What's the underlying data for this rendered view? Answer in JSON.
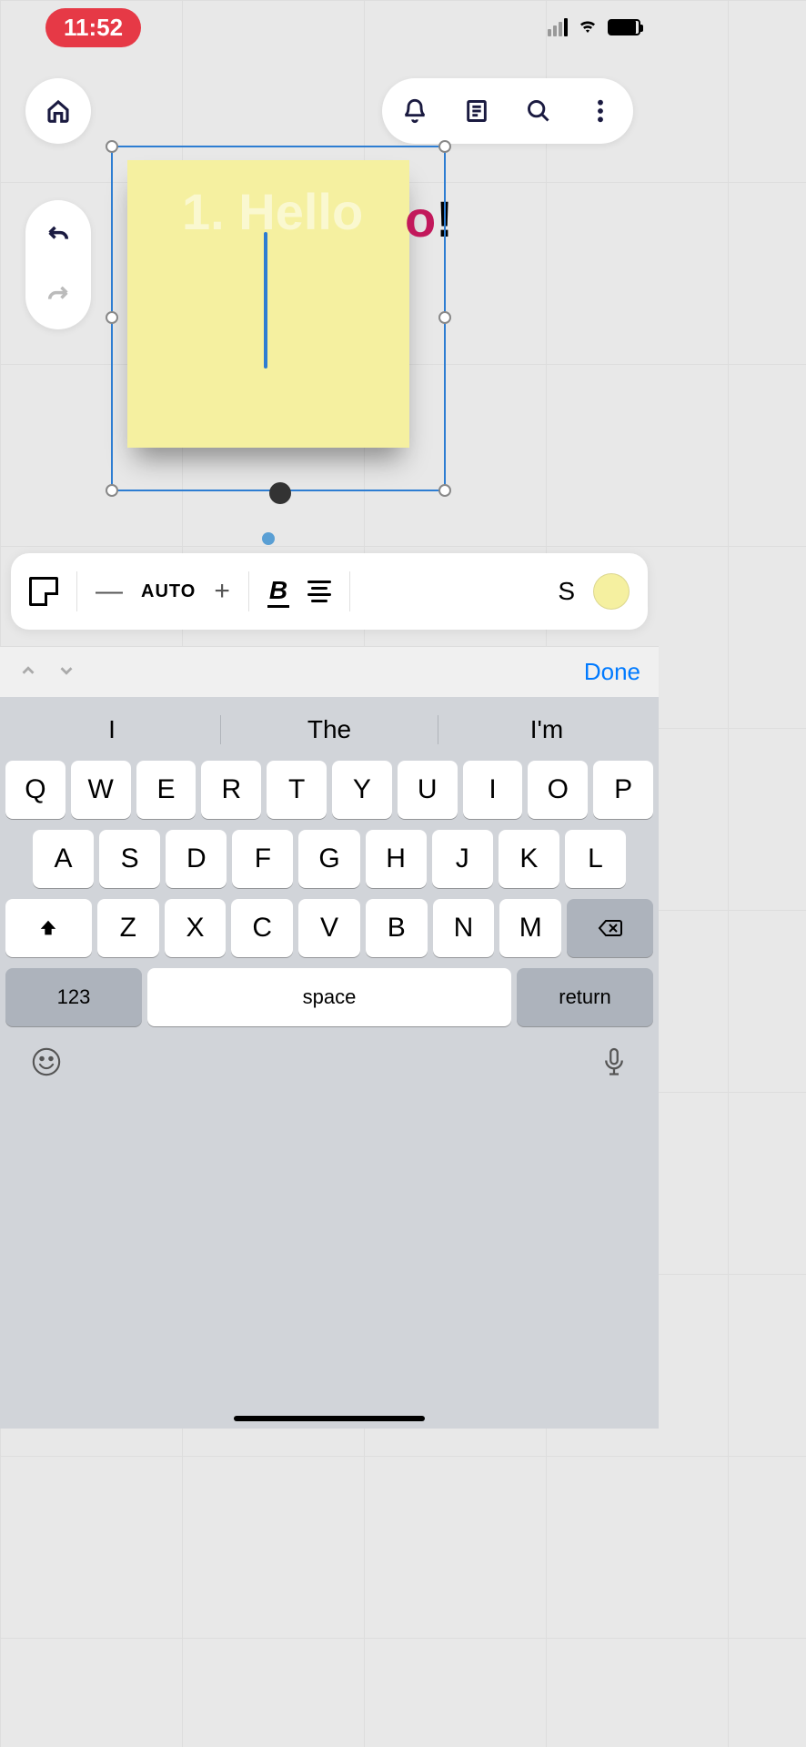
{
  "status": {
    "time": "11:52"
  },
  "canvas": {
    "hidden_text": "1. Hello",
    "overflow_o": "o",
    "overflow_ex": "!"
  },
  "format": {
    "size_mode": "AUTO",
    "style_letter": "S"
  },
  "kb_accessory": {
    "done": "Done"
  },
  "suggestions": [
    "I",
    "The",
    "I'm"
  ],
  "rows": {
    "r1": [
      "Q",
      "W",
      "E",
      "R",
      "T",
      "Y",
      "U",
      "I",
      "O",
      "P"
    ],
    "r2": [
      "A",
      "S",
      "D",
      "F",
      "G",
      "H",
      "J",
      "K",
      "L"
    ],
    "r3": [
      "Z",
      "X",
      "C",
      "V",
      "B",
      "N",
      "M"
    ]
  },
  "keys": {
    "numbers": "123",
    "space": "space",
    "ret": "return"
  }
}
